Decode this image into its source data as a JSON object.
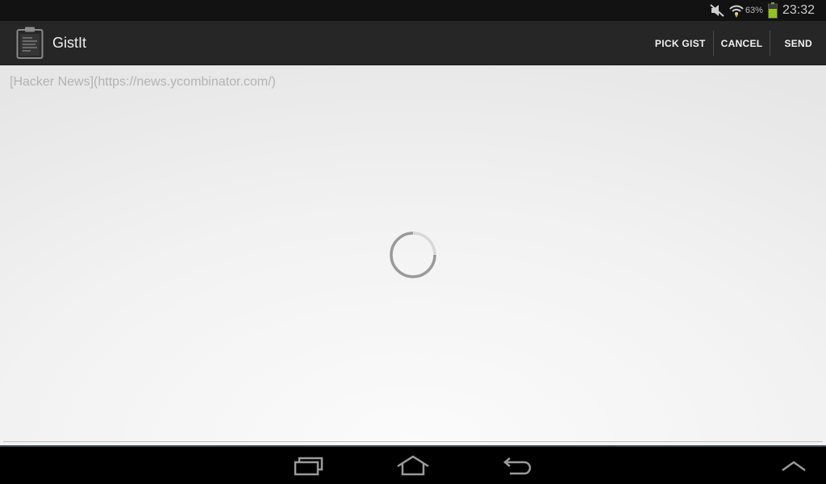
{
  "status_bar": {
    "battery_percent": "63%",
    "battery_level": 0.63,
    "time": "23:32",
    "icons": [
      "mute-icon",
      "wifi-icon",
      "battery-icon"
    ]
  },
  "action_bar": {
    "app_icon": "clipboard-icon",
    "title": "GistIt",
    "actions": {
      "pick_gist": "PICK GIST",
      "cancel": "CANCEL",
      "send": "SEND"
    }
  },
  "content": {
    "text": "[Hacker News](https://news.ycombinator.com/)",
    "loading_indicator": "spinner-icon"
  },
  "nav_bar": {
    "icons": [
      "recent-apps-icon",
      "home-icon",
      "back-icon",
      "expand-up-icon"
    ]
  },
  "colors": {
    "action_bar_bg": "#262626",
    "status_bar_bg": "#121212",
    "content_bg": "#f0f0f0",
    "battery_green": "#8fc31f"
  }
}
